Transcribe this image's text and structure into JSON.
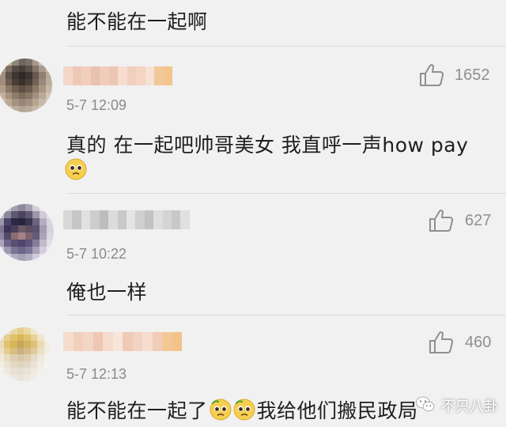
{
  "top_comment": {
    "text": "能不能在一起啊"
  },
  "comments": [
    {
      "timestamp": "5-7 12:09",
      "text": "真的 在一起吧帅哥美女 我直呼一声how pay",
      "emoji": "pleading-face-emoji",
      "likes": "1652"
    },
    {
      "timestamp": "5-7 10:22",
      "text": "俺也一样",
      "likes": "627"
    },
    {
      "timestamp": "5-7 12:13",
      "text_before_emoji": "能不能在一起了",
      "emojis": [
        "pleading-face-emoji",
        "pleading-face-emoji"
      ],
      "text_after_emoji": "我给他们搬民政局",
      "likes": "460"
    }
  ],
  "watermark": {
    "text": "不只八卦",
    "icon": "wechat-icon"
  },
  "colors": {
    "background": "#f1f1f1",
    "divider": "#dcdcdc",
    "meta_gray": "#8a8a8a"
  }
}
